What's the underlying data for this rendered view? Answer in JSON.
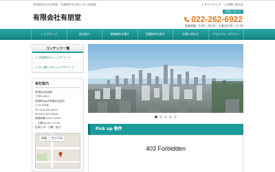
{
  "header": {
    "tagline": "宮城県仙台市の賃貸・売買物件をお探しなら有朋堂",
    "title": "有限会社有朋堂",
    "top_links": [
      "サイトマップ",
      "お問い合わせ"
    ],
    "contact_badge": "お問い合わせ",
    "phone": "022-262-6922",
    "hours": "営業時間：9:00～18:00／土曜日9:00～17:00"
  },
  "nav": {
    "items": [
      "トップページ",
      "会社紹介",
      "賃貸物件を探す",
      "売買物件を探す",
      "お問い合わせ",
      "プライバシーポリシー"
    ]
  },
  "sidebar": {
    "content_title": "コンテンツ一覧",
    "links": [
      "内見時のチェックポイント",
      "引っ越しのチェックポイント"
    ],
    "company_title": "会社案内",
    "company_lines": [
      "有限会社有朋堂",
      "〒980-0824",
      "宮城県仙台市青葉区支倉町",
      "2-23-505号",
      "TEL:022-262-6922",
      "FAX:022-262-6926",
      "営業時間:9:00～18:00",
      "　土曜日9:00～17:00",
      "定休日:水・日曜・祝日"
    ],
    "map_tabs": [
      "地図",
      "航空写真"
    ]
  },
  "main": {
    "pickup_title": "Pick up 物件",
    "error_text": "403 Forbidden",
    "slide_count": 5,
    "active_slide": 1
  },
  "colors": {
    "accent": "#1a9b9b",
    "phone": "#e8731c"
  }
}
